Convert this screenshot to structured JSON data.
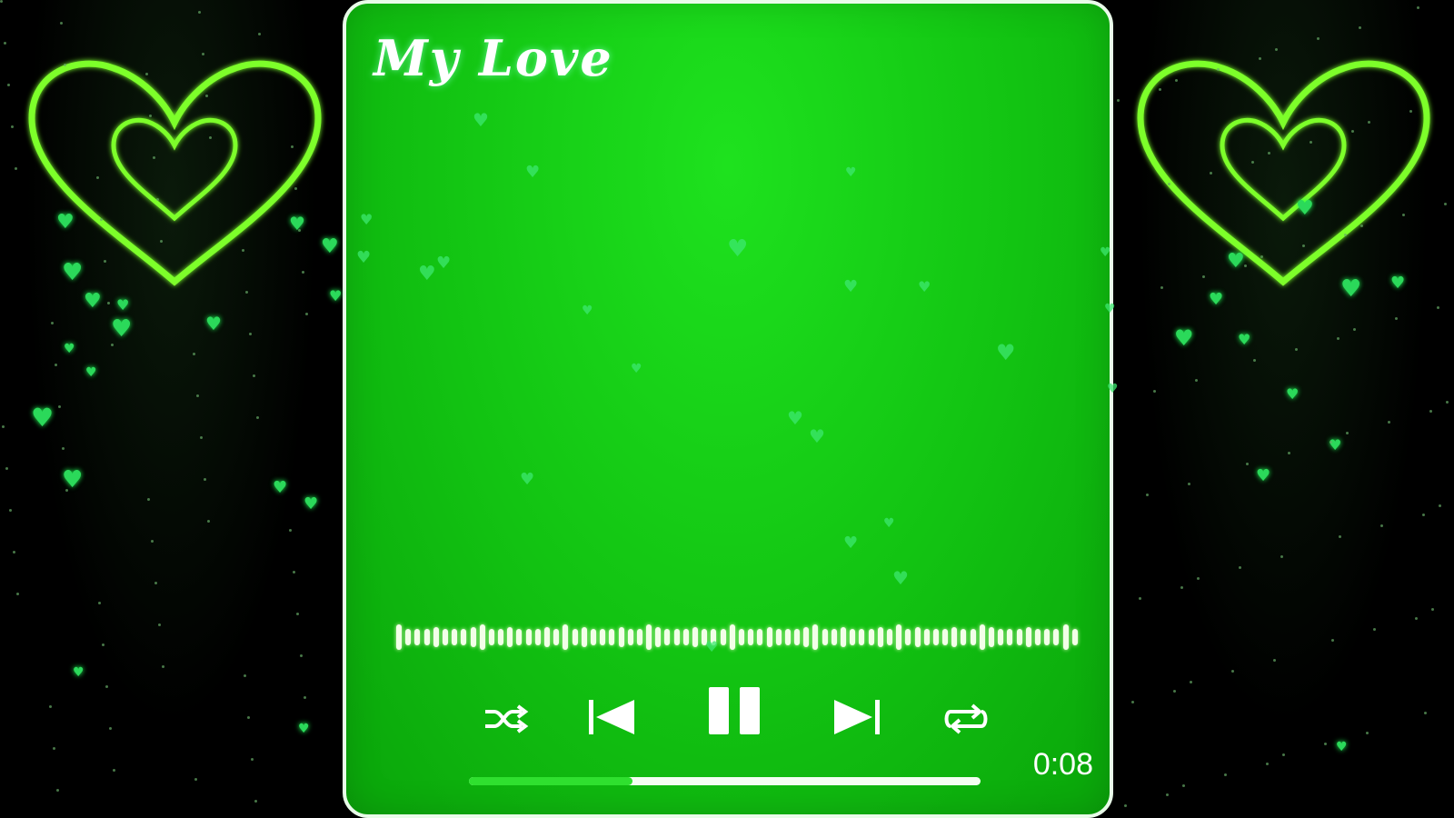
{
  "player": {
    "title": "My Love",
    "current_time": "0:08",
    "progress_fraction": 0.32,
    "state": "playing"
  },
  "controls": {
    "shuffle_icon": "shuffle-icon",
    "previous_icon": "skip-previous-icon",
    "pause_icon": "pause-icon",
    "next_icon": "skip-next-icon",
    "repeat_icon": "repeat-icon"
  },
  "decoration": {
    "side_heart_icon": "heart-outline-icon",
    "floating_heart_icon": "heart-icon"
  },
  "colors": {
    "card_green": "#14c414",
    "accent_green": "#2fe02f",
    "heart_green": "#2bd95a",
    "white": "#ffffff"
  }
}
